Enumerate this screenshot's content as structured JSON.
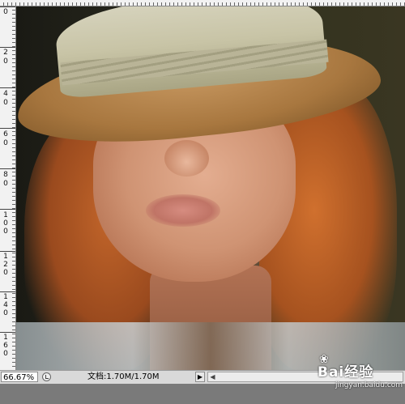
{
  "rulers": {
    "left_labels": [
      "2",
      "0",
      "2",
      "0",
      "4",
      "0",
      "6",
      "0",
      "8",
      "0",
      "1",
      "0",
      "0",
      "1",
      "2",
      "0",
      "1",
      "4",
      "0",
      "1",
      "6",
      "0"
    ]
  },
  "status_bar": {
    "zoom": "66.67%",
    "doc_info": "文档:1.70M/1.70M",
    "menu_arrow": "▶",
    "scroll_left": "◀"
  },
  "watermark": {
    "brand": "Bai经验",
    "url": "jingyan.baidu.com"
  },
  "colors": {
    "statusbar_bg": "#d9d9d9",
    "ruler_bg": "#f2f2f2",
    "workspace_bg": "#7a7a7a"
  }
}
